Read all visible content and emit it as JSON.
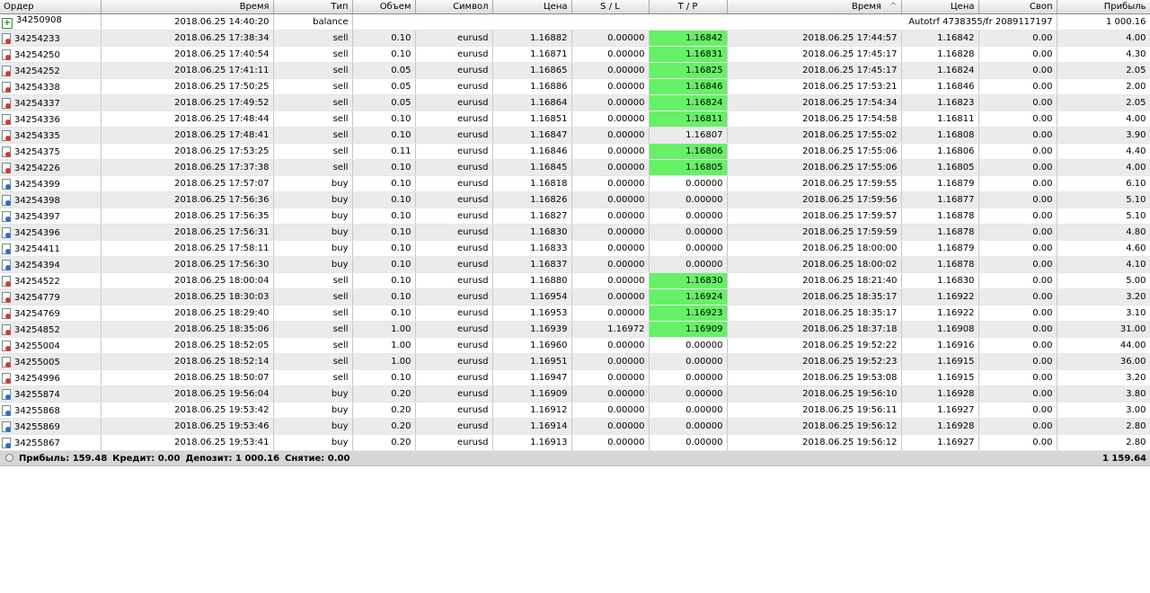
{
  "columns": [
    "Ордер",
    "Время",
    "Тип",
    "Объем",
    "Символ",
    "Цена",
    "S / L",
    "T / P",
    "Время",
    "Цена",
    "Своп",
    "Прибыль"
  ],
  "sort_indicator": "^",
  "balance_row": {
    "order": "34250908",
    "time": "2018.06.25 14:40:20",
    "type": "balance",
    "comment": "Autotrf 4738355/fr 2089117197",
    "profit": "1 000.16"
  },
  "trades": [
    {
      "order": "34254233",
      "open_time": "2018.06.25 17:38:34",
      "type": "sell",
      "volume": "0.10",
      "symbol": "eurusd",
      "open_price": "1.16882",
      "sl": "0.00000",
      "tp": "1.16842",
      "tp_hit": true,
      "close_time": "2018.06.25 17:44:57",
      "close_price": "1.16842",
      "swap": "0.00",
      "profit": "4.00"
    },
    {
      "order": "34254250",
      "open_time": "2018.06.25 17:40:54",
      "type": "sell",
      "volume": "0.10",
      "symbol": "eurusd",
      "open_price": "1.16871",
      "sl": "0.00000",
      "tp": "1.16831",
      "tp_hit": true,
      "close_time": "2018.06.25 17:45:17",
      "close_price": "1.16828",
      "swap": "0.00",
      "profit": "4.30"
    },
    {
      "order": "34254252",
      "open_time": "2018.06.25 17:41:11",
      "type": "sell",
      "volume": "0.05",
      "symbol": "eurusd",
      "open_price": "1.16865",
      "sl": "0.00000",
      "tp": "1.16825",
      "tp_hit": true,
      "close_time": "2018.06.25 17:45:17",
      "close_price": "1.16824",
      "swap": "0.00",
      "profit": "2.05"
    },
    {
      "order": "34254338",
      "open_time": "2018.06.25 17:50:25",
      "type": "sell",
      "volume": "0.05",
      "symbol": "eurusd",
      "open_price": "1.16886",
      "sl": "0.00000",
      "tp": "1.16846",
      "tp_hit": true,
      "close_time": "2018.06.25 17:53:21",
      "close_price": "1.16846",
      "swap": "0.00",
      "profit": "2.00"
    },
    {
      "order": "34254337",
      "open_time": "2018.06.25 17:49:52",
      "type": "sell",
      "volume": "0.05",
      "symbol": "eurusd",
      "open_price": "1.16864",
      "sl": "0.00000",
      "tp": "1.16824",
      "tp_hit": true,
      "close_time": "2018.06.25 17:54:34",
      "close_price": "1.16823",
      "swap": "0.00",
      "profit": "2.05"
    },
    {
      "order": "34254336",
      "open_time": "2018.06.25 17:48:44",
      "type": "sell",
      "volume": "0.10",
      "symbol": "eurusd",
      "open_price": "1.16851",
      "sl": "0.00000",
      "tp": "1.16811",
      "tp_hit": true,
      "close_time": "2018.06.25 17:54:58",
      "close_price": "1.16811",
      "swap": "0.00",
      "profit": "4.00"
    },
    {
      "order": "34254335",
      "open_time": "2018.06.25 17:48:41",
      "type": "sell",
      "volume": "0.10",
      "symbol": "eurusd",
      "open_price": "1.16847",
      "sl": "0.00000",
      "tp": "1.16807",
      "tp_hit": false,
      "close_time": "2018.06.25 17:55:02",
      "close_price": "1.16808",
      "swap": "0.00",
      "profit": "3.90"
    },
    {
      "order": "34254375",
      "open_time": "2018.06.25 17:53:25",
      "type": "sell",
      "volume": "0.11",
      "symbol": "eurusd",
      "open_price": "1.16846",
      "sl": "0.00000",
      "tp": "1.16806",
      "tp_hit": true,
      "close_time": "2018.06.25 17:55:06",
      "close_price": "1.16806",
      "swap": "0.00",
      "profit": "4.40"
    },
    {
      "order": "34254226",
      "open_time": "2018.06.25 17:37:38",
      "type": "sell",
      "volume": "0.10",
      "symbol": "eurusd",
      "open_price": "1.16845",
      "sl": "0.00000",
      "tp": "1.16805",
      "tp_hit": true,
      "close_time": "2018.06.25 17:55:06",
      "close_price": "1.16805",
      "swap": "0.00",
      "profit": "4.00"
    },
    {
      "order": "34254399",
      "open_time": "2018.06.25 17:57:07",
      "type": "buy",
      "volume": "0.10",
      "symbol": "eurusd",
      "open_price": "1.16818",
      "sl": "0.00000",
      "tp": "0.00000",
      "tp_hit": false,
      "close_time": "2018.06.25 17:59:55",
      "close_price": "1.16879",
      "swap": "0.00",
      "profit": "6.10"
    },
    {
      "order": "34254398",
      "open_time": "2018.06.25 17:56:36",
      "type": "buy",
      "volume": "0.10",
      "symbol": "eurusd",
      "open_price": "1.16826",
      "sl": "0.00000",
      "tp": "0.00000",
      "tp_hit": false,
      "close_time": "2018.06.25 17:59:56",
      "close_price": "1.16877",
      "swap": "0.00",
      "profit": "5.10"
    },
    {
      "order": "34254397",
      "open_time": "2018.06.25 17:56:35",
      "type": "buy",
      "volume": "0.10",
      "symbol": "eurusd",
      "open_price": "1.16827",
      "sl": "0.00000",
      "tp": "0.00000",
      "tp_hit": false,
      "close_time": "2018.06.25 17:59:57",
      "close_price": "1.16878",
      "swap": "0.00",
      "profit": "5.10"
    },
    {
      "order": "34254396",
      "open_time": "2018.06.25 17:56:31",
      "type": "buy",
      "volume": "0.10",
      "symbol": "eurusd",
      "open_price": "1.16830",
      "sl": "0.00000",
      "tp": "0.00000",
      "tp_hit": false,
      "close_time": "2018.06.25 17:59:59",
      "close_price": "1.16878",
      "swap": "0.00",
      "profit": "4.80"
    },
    {
      "order": "34254411",
      "open_time": "2018.06.25 17:58:11",
      "type": "buy",
      "volume": "0.10",
      "symbol": "eurusd",
      "open_price": "1.16833",
      "sl": "0.00000",
      "tp": "0.00000",
      "tp_hit": false,
      "close_time": "2018.06.25 18:00:00",
      "close_price": "1.16879",
      "swap": "0.00",
      "profit": "4.60"
    },
    {
      "order": "34254394",
      "open_time": "2018.06.25 17:56:30",
      "type": "buy",
      "volume": "0.10",
      "symbol": "eurusd",
      "open_price": "1.16837",
      "sl": "0.00000",
      "tp": "0.00000",
      "tp_hit": false,
      "close_time": "2018.06.25 18:00:02",
      "close_price": "1.16878",
      "swap": "0.00",
      "profit": "4.10"
    },
    {
      "order": "34254522",
      "open_time": "2018.06.25 18:00:04",
      "type": "sell",
      "volume": "0.10",
      "symbol": "eurusd",
      "open_price": "1.16880",
      "sl": "0.00000",
      "tp": "1.16830",
      "tp_hit": true,
      "close_time": "2018.06.25 18:21:40",
      "close_price": "1.16830",
      "swap": "0.00",
      "profit": "5.00"
    },
    {
      "order": "34254779",
      "open_time": "2018.06.25 18:30:03",
      "type": "sell",
      "volume": "0.10",
      "symbol": "eurusd",
      "open_price": "1.16954",
      "sl": "0.00000",
      "tp": "1.16924",
      "tp_hit": true,
      "close_time": "2018.06.25 18:35:17",
      "close_price": "1.16922",
      "swap": "0.00",
      "profit": "3.20"
    },
    {
      "order": "34254769",
      "open_time": "2018.06.25 18:29:40",
      "type": "sell",
      "volume": "0.10",
      "symbol": "eurusd",
      "open_price": "1.16953",
      "sl": "0.00000",
      "tp": "1.16923",
      "tp_hit": true,
      "close_time": "2018.06.25 18:35:17",
      "close_price": "1.16922",
      "swap": "0.00",
      "profit": "3.10"
    },
    {
      "order": "34254852",
      "open_time": "2018.06.25 18:35:06",
      "type": "sell",
      "volume": "1.00",
      "symbol": "eurusd",
      "open_price": "1.16939",
      "sl": "1.16972",
      "tp": "1.16909",
      "tp_hit": true,
      "close_time": "2018.06.25 18:37:18",
      "close_price": "1.16908",
      "swap": "0.00",
      "profit": "31.00"
    },
    {
      "order": "34255004",
      "open_time": "2018.06.25 18:52:05",
      "type": "sell",
      "volume": "1.00",
      "symbol": "eurusd",
      "open_price": "1.16960",
      "sl": "0.00000",
      "tp": "0.00000",
      "tp_hit": false,
      "close_time": "2018.06.25 19:52:22",
      "close_price": "1.16916",
      "swap": "0.00",
      "profit": "44.00"
    },
    {
      "order": "34255005",
      "open_time": "2018.06.25 18:52:14",
      "type": "sell",
      "volume": "1.00",
      "symbol": "eurusd",
      "open_price": "1.16951",
      "sl": "0.00000",
      "tp": "0.00000",
      "tp_hit": false,
      "close_time": "2018.06.25 19:52:23",
      "close_price": "1.16915",
      "swap": "0.00",
      "profit": "36.00"
    },
    {
      "order": "34254996",
      "open_time": "2018.06.25 18:50:07",
      "type": "sell",
      "volume": "0.10",
      "symbol": "eurusd",
      "open_price": "1.16947",
      "sl": "0.00000",
      "tp": "0.00000",
      "tp_hit": false,
      "close_time": "2018.06.25 19:53:08",
      "close_price": "1.16915",
      "swap": "0.00",
      "profit": "3.20"
    },
    {
      "order": "34255874",
      "open_time": "2018.06.25 19:56:04",
      "type": "buy",
      "volume": "0.20",
      "symbol": "eurusd",
      "open_price": "1.16909",
      "sl": "0.00000",
      "tp": "0.00000",
      "tp_hit": false,
      "close_time": "2018.06.25 19:56:10",
      "close_price": "1.16928",
      "swap": "0.00",
      "profit": "3.80"
    },
    {
      "order": "34255868",
      "open_time": "2018.06.25 19:53:42",
      "type": "buy",
      "volume": "0.20",
      "symbol": "eurusd",
      "open_price": "1.16912",
      "sl": "0.00000",
      "tp": "0.00000",
      "tp_hit": false,
      "close_time": "2018.06.25 19:56:11",
      "close_price": "1.16927",
      "swap": "0.00",
      "profit": "3.00"
    },
    {
      "order": "34255869",
      "open_time": "2018.06.25 19:53:46",
      "type": "buy",
      "volume": "0.20",
      "symbol": "eurusd",
      "open_price": "1.16914",
      "sl": "0.00000",
      "tp": "0.00000",
      "tp_hit": false,
      "close_time": "2018.06.25 19:56:12",
      "close_price": "1.16928",
      "swap": "0.00",
      "profit": "2.80"
    },
    {
      "order": "34255867",
      "open_time": "2018.06.25 19:53:41",
      "type": "buy",
      "volume": "0.20",
      "symbol": "eurusd",
      "open_price": "1.16913",
      "sl": "0.00000",
      "tp": "0.00000",
      "tp_hit": false,
      "close_time": "2018.06.25 19:56:12",
      "close_price": "1.16927",
      "swap": "0.00",
      "profit": "2.80"
    }
  ],
  "summary": {
    "profit": "Прибыль: 159.48",
    "credit": "Кредит: 0.00",
    "deposit": "Депозит: 1 000.16",
    "withdrawal": "Снятие: 0.00",
    "total": "1 159.64"
  },
  "colors": {
    "tp_hit": "#66f066",
    "sell_icon": "#d23b2a",
    "buy_icon": "#2a6fc9",
    "balance_icon": "#1c9b1c",
    "summary_bg": "#d6d6d6"
  },
  "icons": {
    "balance": "balance-deposit-icon",
    "sell": "sell-order-icon",
    "buy": "buy-order-icon",
    "summary": "summary-circle-icon"
  }
}
